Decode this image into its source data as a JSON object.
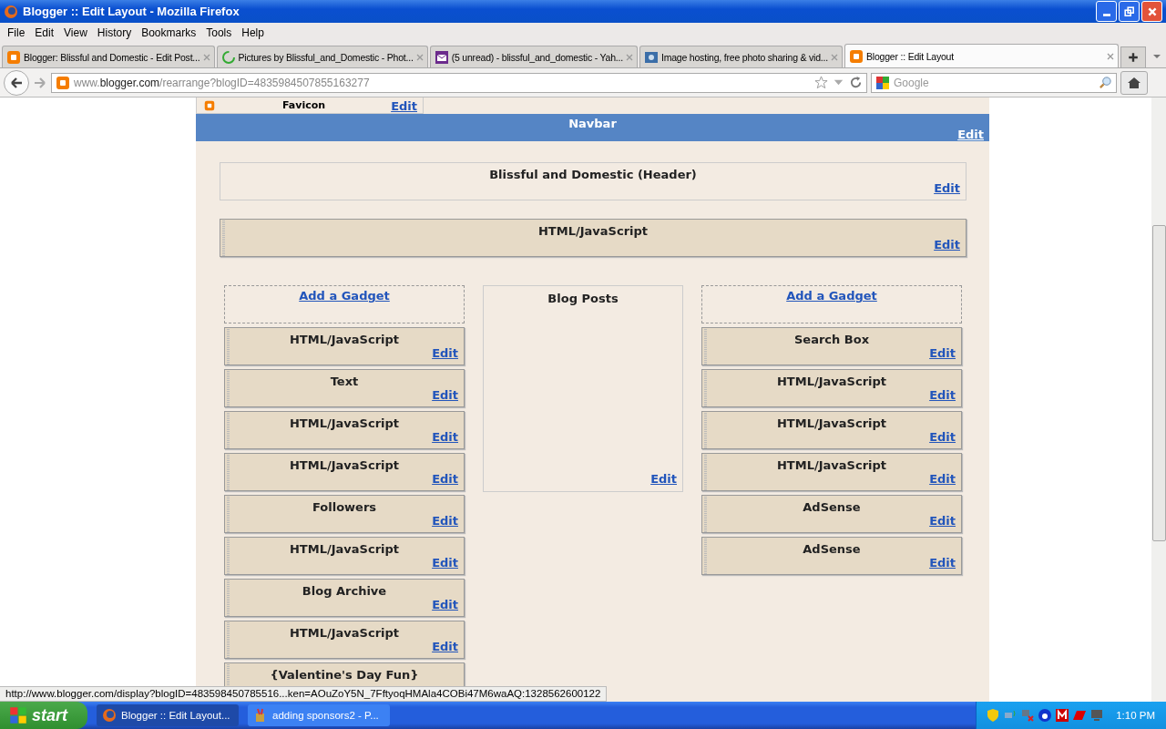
{
  "window": {
    "title": "Blogger :: Edit Layout - Mozilla Firefox"
  },
  "menu": [
    "File",
    "Edit",
    "View",
    "History",
    "Bookmarks",
    "Tools",
    "Help"
  ],
  "tabs": [
    {
      "label": "Blogger: Blissful and Domestic - Edit Post...",
      "kind": "blogger",
      "selected": false
    },
    {
      "label": "Pictures by Blissful_and_Domestic - Phot...",
      "kind": "loading",
      "selected": false
    },
    {
      "label": "(5 unread) - blissful_and_domestic - Yah...",
      "kind": "mail",
      "selected": false
    },
    {
      "label": "Image hosting, free photo sharing & vid...",
      "kind": "photo",
      "selected": false
    },
    {
      "label": "Blogger :: Edit Layout",
      "kind": "blogger",
      "selected": true
    }
  ],
  "address": {
    "prefix": "www.",
    "domain": "blogger.com",
    "path": "/rearrange?blogID=4835984507855163277"
  },
  "search": {
    "placeholder": "Google"
  },
  "layout": {
    "favicon": {
      "title": "Favicon",
      "edit": "Edit"
    },
    "navbar": {
      "title": "Navbar",
      "edit": "Edit"
    },
    "header": {
      "title": "Blissful and Domestic (Header)",
      "edit": "Edit"
    },
    "top_gadget": {
      "title": "HTML/JavaScript",
      "edit": "Edit"
    },
    "left": {
      "add": "Add a Gadget",
      "gadgets": [
        {
          "title": "HTML/JavaScript",
          "edit": "Edit"
        },
        {
          "title": "Text",
          "edit": "Edit"
        },
        {
          "title": "HTML/JavaScript",
          "edit": "Edit"
        },
        {
          "title": "HTML/JavaScript",
          "edit": "Edit"
        },
        {
          "title": "Followers",
          "edit": "Edit"
        },
        {
          "title": "HTML/JavaScript",
          "edit": "Edit"
        },
        {
          "title": "Blog Archive",
          "edit": "Edit"
        },
        {
          "title": "HTML/JavaScript",
          "edit": "Edit"
        },
        {
          "title": "{Valentine's Day Fun}"
        }
      ]
    },
    "main": {
      "title": "Blog Posts",
      "edit": "Edit"
    },
    "right": {
      "add": "Add a Gadget",
      "gadgets": [
        {
          "title": "Search Box",
          "edit": "Edit"
        },
        {
          "title": "HTML/JavaScript",
          "edit": "Edit"
        },
        {
          "title": "HTML/JavaScript",
          "edit": "Edit"
        },
        {
          "title": "HTML/JavaScript",
          "edit": "Edit"
        },
        {
          "title": "AdSense",
          "edit": "Edit"
        },
        {
          "title": "AdSense",
          "edit": "Edit"
        }
      ]
    }
  },
  "status_text": "http://www.blogger.com/display?blogID=483598450785516...ken=AOuZoY5N_7FftyoqHMAla4COBi47M6waAQ:1328562600122",
  "taskbar": {
    "start": "start",
    "tasks": [
      {
        "label": "Blogger :: Edit Layout...",
        "kind": "firefox",
        "selected": true
      },
      {
        "label": "adding sponsors2 - P...",
        "kind": "paint",
        "selected": false
      }
    ],
    "clock": "1:10 PM"
  }
}
